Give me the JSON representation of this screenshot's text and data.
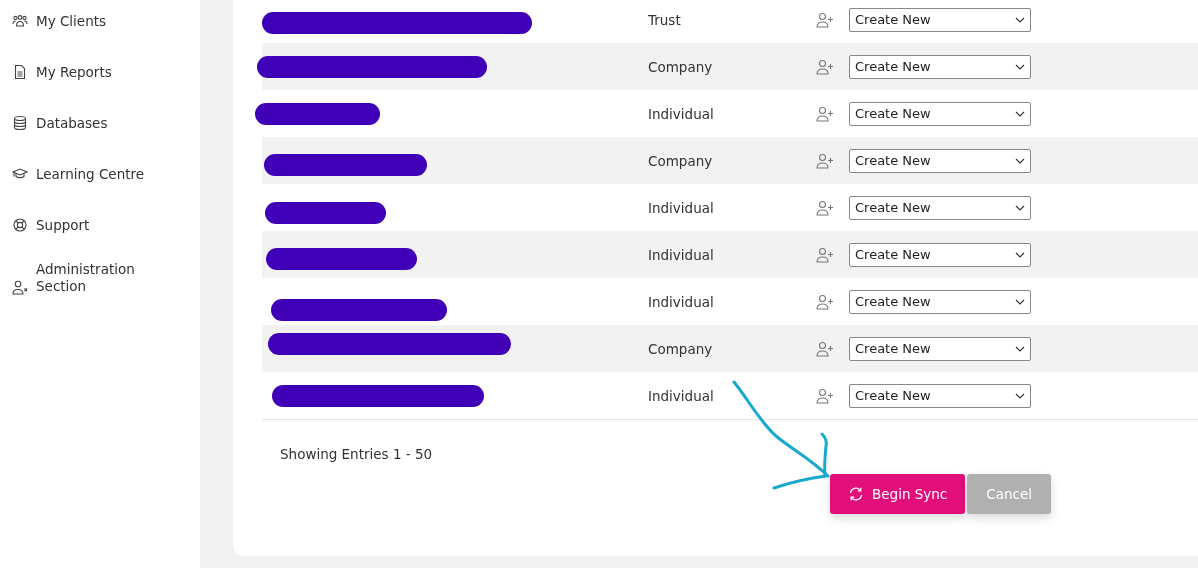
{
  "sidebar": {
    "items": [
      {
        "label": "My Clients"
      },
      {
        "label": "My Reports"
      },
      {
        "label": "Databases"
      },
      {
        "label": "Learning Centre"
      },
      {
        "label": "Support"
      },
      {
        "label": "Administration Section"
      }
    ]
  },
  "table": {
    "rows": [
      {
        "redacted": true,
        "type": "Trust",
        "action": "Create New"
      },
      {
        "redacted": true,
        "type": "Company",
        "action": "Create New"
      },
      {
        "redacted": true,
        "type": "Individual",
        "action": "Create New"
      },
      {
        "redacted": true,
        "type": "Company",
        "action": "Create New"
      },
      {
        "redacted": true,
        "type": "Individual",
        "action": "Create New"
      },
      {
        "redacted": true,
        "type": "Individual",
        "action": "Create New"
      },
      {
        "redacted": true,
        "type": "Individual",
        "action": "Create New"
      },
      {
        "redacted": true,
        "type": "Company",
        "action": "Create New"
      },
      {
        "redacted": true,
        "type": "Individual",
        "action": "Create New"
      }
    ]
  },
  "footer": {
    "entries": "Showing Entries 1 - 50"
  },
  "buttons": [
    {
      "label": "Begin Sync",
      "kind": "primary"
    },
    {
      "label": "Cancel",
      "kind": "secondary"
    }
  ]
}
